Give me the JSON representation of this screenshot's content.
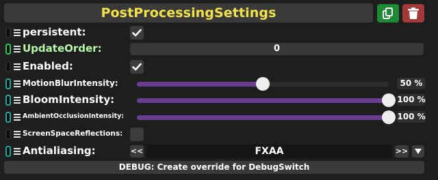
{
  "header": {
    "title": "PostProcessingSettings",
    "copy_icon": "copy-icon",
    "delete_icon": "trash-icon"
  },
  "colors": {
    "title": "#f2e34a",
    "accent_green": "#1f8a35",
    "accent_red": "#a23a3a",
    "slider_fill": "#6b3d91",
    "modified_label": "#b6f7a8"
  },
  "rows": {
    "persistent": {
      "label": "persistent:",
      "checked": true
    },
    "update_order": {
      "label": "UpdateOrder:",
      "value": "0"
    },
    "enabled": {
      "label": "Enabled:",
      "checked": true
    },
    "motion_blur": {
      "label": "MotionBlurIntensity:",
      "value_pct": 50,
      "display": "50 %"
    },
    "bloom": {
      "label": "BloomIntensity:",
      "value_pct": 100,
      "display": "100 %"
    },
    "ambient_occlusion": {
      "label": "AmbientOcclusionIntensity:",
      "value_pct": 100,
      "display": "100 %"
    },
    "ssr": {
      "label": "ScreenSpaceReflections:",
      "checked": false
    },
    "antialiasing": {
      "label": "Antialiasing:",
      "prev_label": "<<",
      "next_label": ">>",
      "value": "FXAA"
    }
  },
  "debug": {
    "label": "DEBUG: Create override for DebugSwitch"
  }
}
